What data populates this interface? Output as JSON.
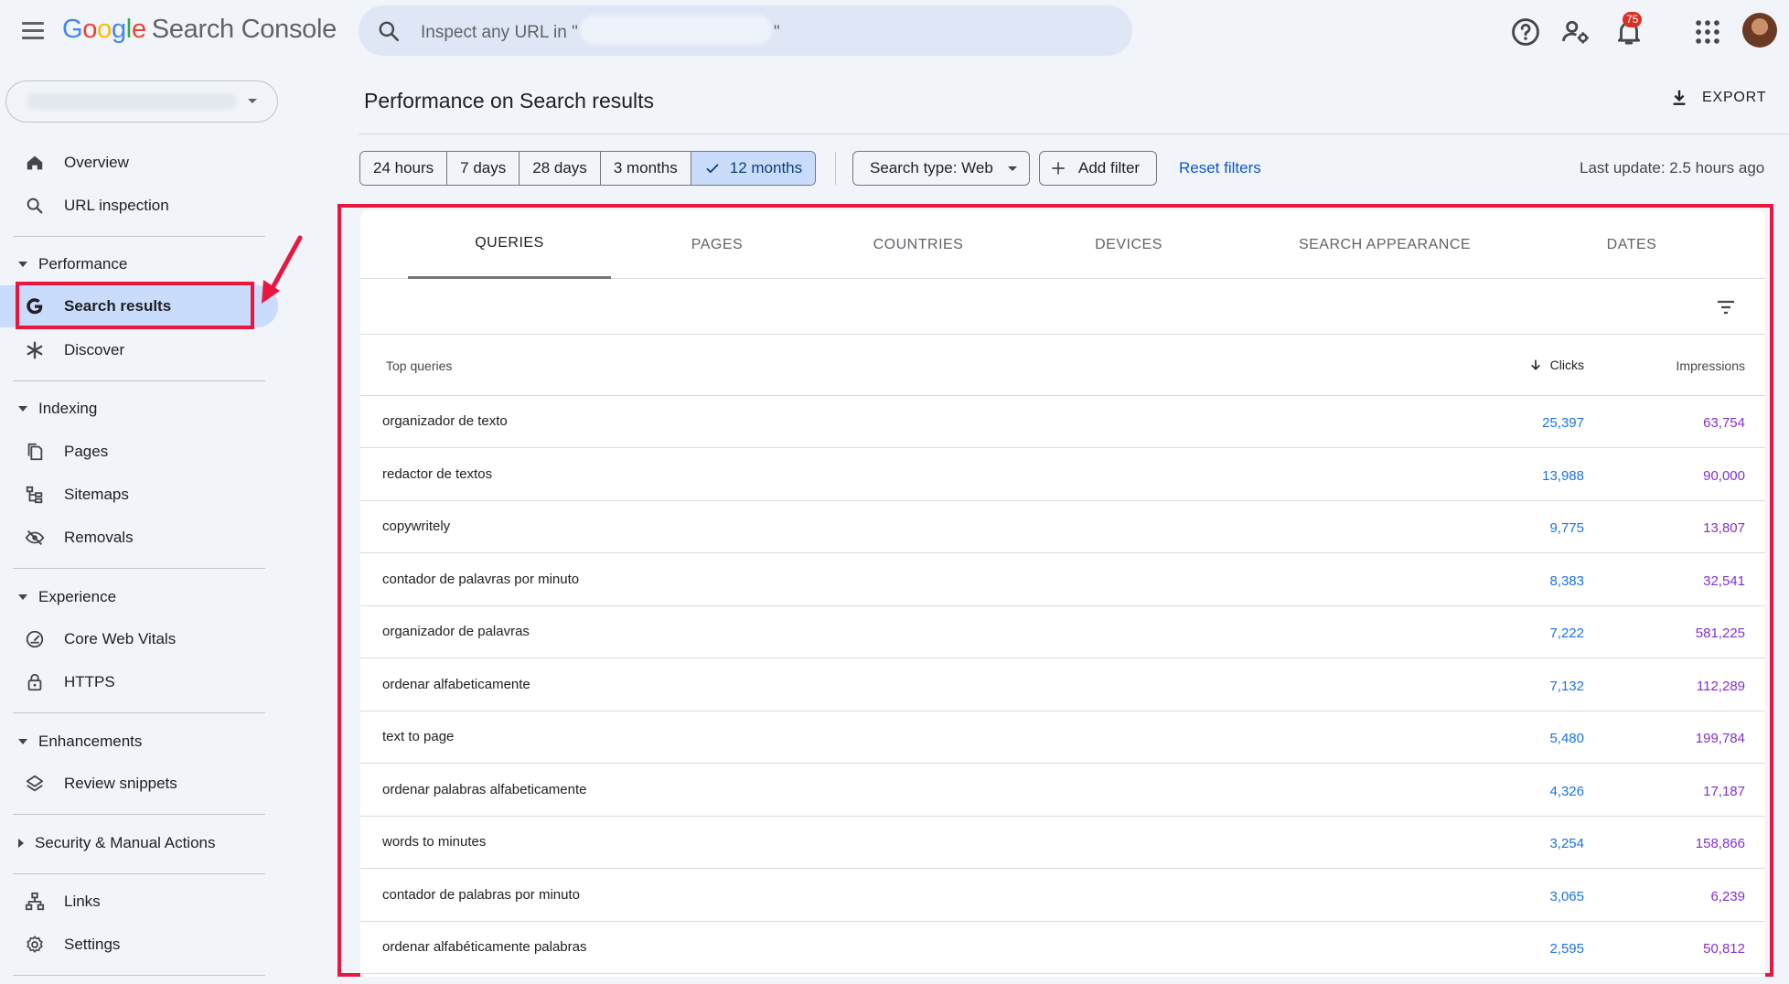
{
  "topbar": {
    "logo_letters": [
      "G",
      "o",
      "o",
      "g",
      "l",
      "e"
    ],
    "product_name": "Search Console",
    "search_placeholder_prefix": "Inspect any URL in \"",
    "search_placeholder_suffix": "\"",
    "notifications_count": "75",
    "icons": [
      "menu-icon",
      "search-icon",
      "help-icon",
      "manage-users-icon",
      "notifications-icon",
      "apps-grid-icon"
    ]
  },
  "sidebar": {
    "items_top": [
      {
        "label": "Overview",
        "icon": "home-icon"
      },
      {
        "label": "URL inspection",
        "icon": "search-icon"
      }
    ],
    "sections": [
      {
        "label": "Performance",
        "expanded": true,
        "items": [
          {
            "label": "Search results",
            "icon": "google-g-icon",
            "active": true
          },
          {
            "label": "Discover",
            "icon": "asterisk-icon"
          }
        ]
      },
      {
        "label": "Indexing",
        "expanded": true,
        "items": [
          {
            "label": "Pages",
            "icon": "pages-icon"
          },
          {
            "label": "Sitemaps",
            "icon": "sitemap-icon"
          },
          {
            "label": "Removals",
            "icon": "eye-off-icon"
          }
        ]
      },
      {
        "label": "Experience",
        "expanded": true,
        "items": [
          {
            "label": "Core Web Vitals",
            "icon": "gauge-icon"
          },
          {
            "label": "HTTPS",
            "icon": "lock-icon"
          }
        ]
      },
      {
        "label": "Enhancements",
        "expanded": true,
        "items": [
          {
            "label": "Review snippets",
            "icon": "layers-icon"
          }
        ]
      },
      {
        "label": "Security & Manual Actions",
        "expanded": false,
        "items": []
      }
    ],
    "items_bottom": [
      {
        "label": "Links",
        "icon": "links-icon"
      },
      {
        "label": "Settings",
        "icon": "settings-icon"
      }
    ]
  },
  "main": {
    "title": "Performance on Search results",
    "export_label": "EXPORT",
    "date_ranges": [
      "24 hours",
      "7 days",
      "28 days",
      "3 months",
      "12 months"
    ],
    "selected_range": "12 months",
    "search_type_label": "Search type: Web",
    "add_filter_label": "Add filter",
    "reset_filters_label": "Reset filters",
    "last_update": "Last update: 2.5 hours ago",
    "tabs": [
      "QUERIES",
      "PAGES",
      "COUNTRIES",
      "DEVICES",
      "SEARCH APPEARANCE",
      "DATES"
    ],
    "active_tab": "QUERIES",
    "table": {
      "col_query": "Top queries",
      "col_clicks": "Clicks",
      "col_impressions": "Impressions",
      "rows": [
        {
          "query": "organizador de texto",
          "clicks": "25,397",
          "impressions": "63,754"
        },
        {
          "query": "redactor de textos",
          "clicks": "13,988",
          "impressions": "90,000"
        },
        {
          "query": "copywritely",
          "clicks": "9,775",
          "impressions": "13,807"
        },
        {
          "query": "contador de palavras por minuto",
          "clicks": "8,383",
          "impressions": "32,541"
        },
        {
          "query": "organizador de palavras",
          "clicks": "7,222",
          "impressions": "581,225"
        },
        {
          "query": "ordenar alfabeticamente",
          "clicks": "7,132",
          "impressions": "112,289"
        },
        {
          "query": "text to page",
          "clicks": "5,480",
          "impressions": "199,784"
        },
        {
          "query": "ordenar palabras alfabeticamente",
          "clicks": "4,326",
          "impressions": "17,187"
        },
        {
          "query": "words to minutes",
          "clicks": "3,254",
          "impressions": "158,866"
        },
        {
          "query": "contador de palabras por minuto",
          "clicks": "3,065",
          "impressions": "6,239"
        },
        {
          "query": "ordenar alfabéticamente palabras",
          "clicks": "2,595",
          "impressions": "50,812"
        }
      ]
    }
  },
  "colors": {
    "annotation_red": "#e8173f",
    "clicks_blue": "#1a73e8",
    "impressions_purple": "#8430ce",
    "active_nav_bg": "#c9dcfb"
  }
}
